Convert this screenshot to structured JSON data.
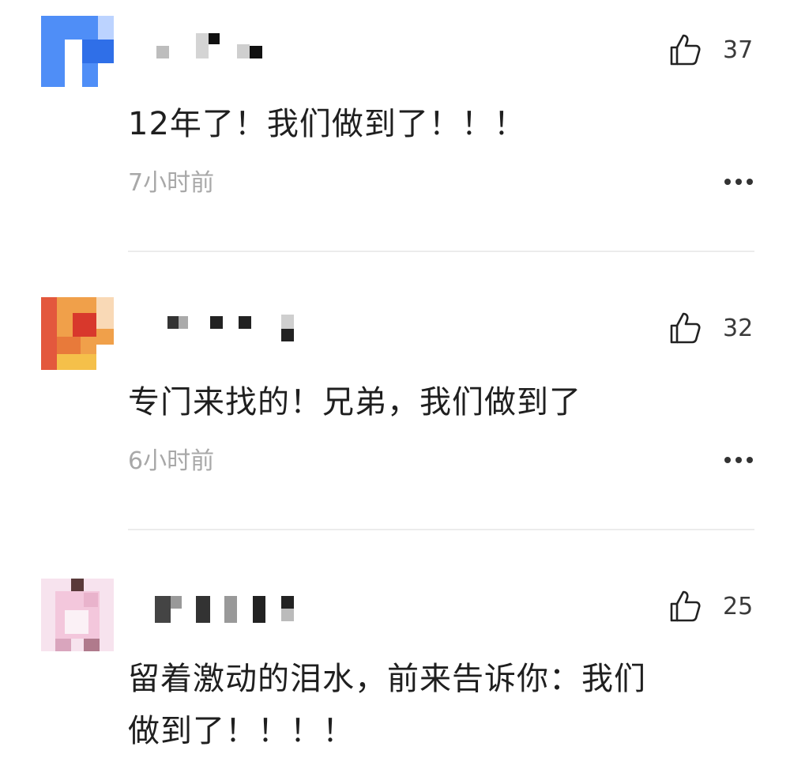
{
  "comments": [
    {
      "username_hidden": true,
      "likes": "37",
      "text": "12年了！我们做到了！！！",
      "time": "7小时前",
      "avatar_colors": [
        "#4f8ef7",
        "#2f6fe8",
        "#7aa8ff"
      ]
    },
    {
      "username_hidden": true,
      "likes": "32",
      "text": "专门来找的！兄弟，我们做到了",
      "time": "6小时前",
      "avatar_colors": [
        "#e0463a",
        "#f0a04a",
        "#f5c04a"
      ]
    },
    {
      "username_hidden": true,
      "likes": "25",
      "text_line1": "留着激动的泪水，前来告诉你：我们",
      "text_line2": "做到了！！！！",
      "avatar_colors": [
        "#f3c7dc",
        "#e9b3cc",
        "#b07a8c"
      ]
    }
  ],
  "colors": {
    "text": "#1f1f1f",
    "muted": "#a8a8a8",
    "divider": "#ececec"
  },
  "icons": {
    "like": "thumbs-up-icon",
    "more": "more-dots-icon"
  }
}
